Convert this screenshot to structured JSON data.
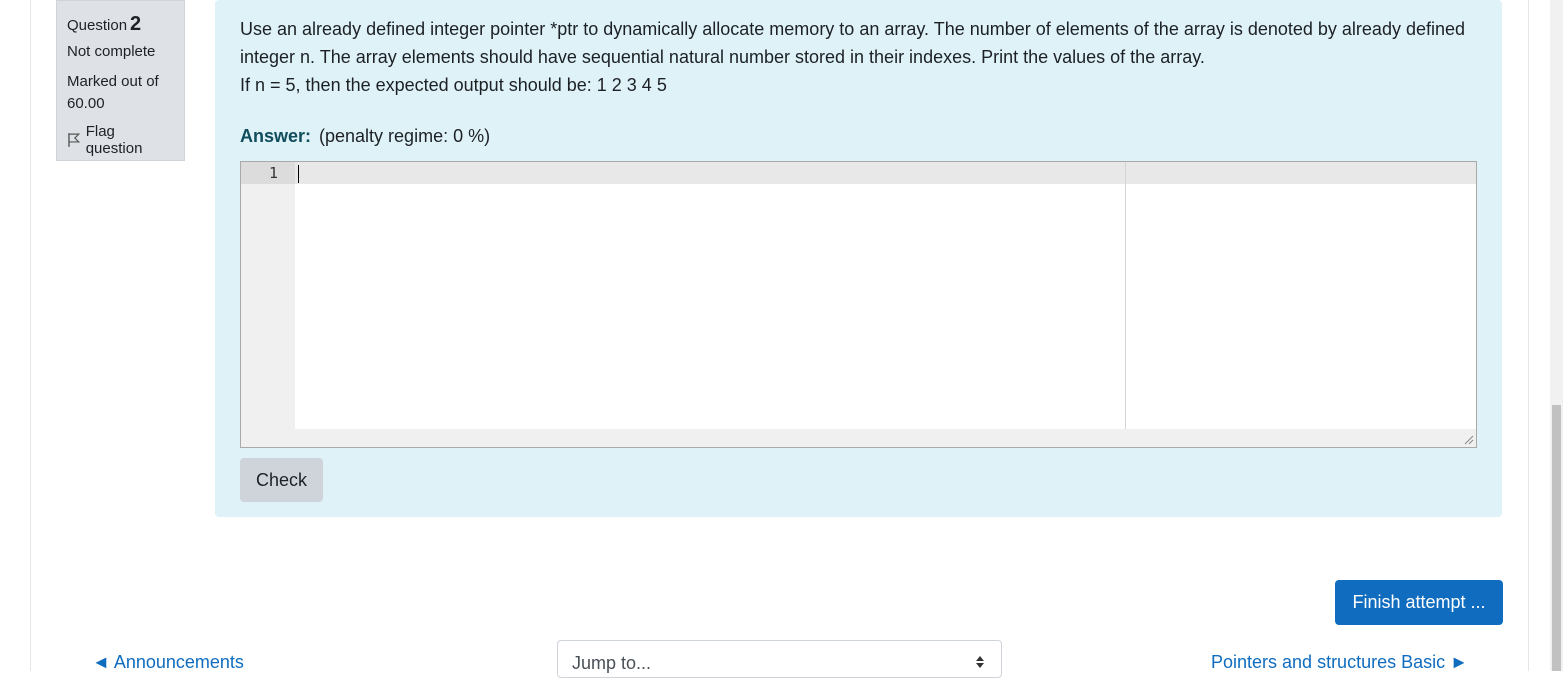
{
  "question_info": {
    "label": "Question",
    "number": "2",
    "state": "Not complete",
    "grade": "Marked out of 60.00",
    "flag_label": "Flag question"
  },
  "question_text": {
    "line1": "Use an already defined integer pointer *ptr to dynamically allocate memory to an array. The number of elements of the array is denoted by already defined integer n. The array elements should have sequential natural number stored in their indexes. Print the values of the array.",
    "line2": "If n = 5, then the expected output should be: 1 2 3 4 5"
  },
  "answer": {
    "label": "Answer:",
    "penalty": "(penalty regime: 0 %)",
    "line_number": "1",
    "code": ""
  },
  "buttons": {
    "check": "Check",
    "finish": "Finish attempt ..."
  },
  "navigation": {
    "prev": "◄ Announcements",
    "jump_placeholder": "Jump to...",
    "next": "Pointers and structures Basic ►"
  },
  "colors": {
    "content_bg": "#def2f8",
    "primary": "#0f6cbf",
    "info_bg": "#dee2e6"
  }
}
